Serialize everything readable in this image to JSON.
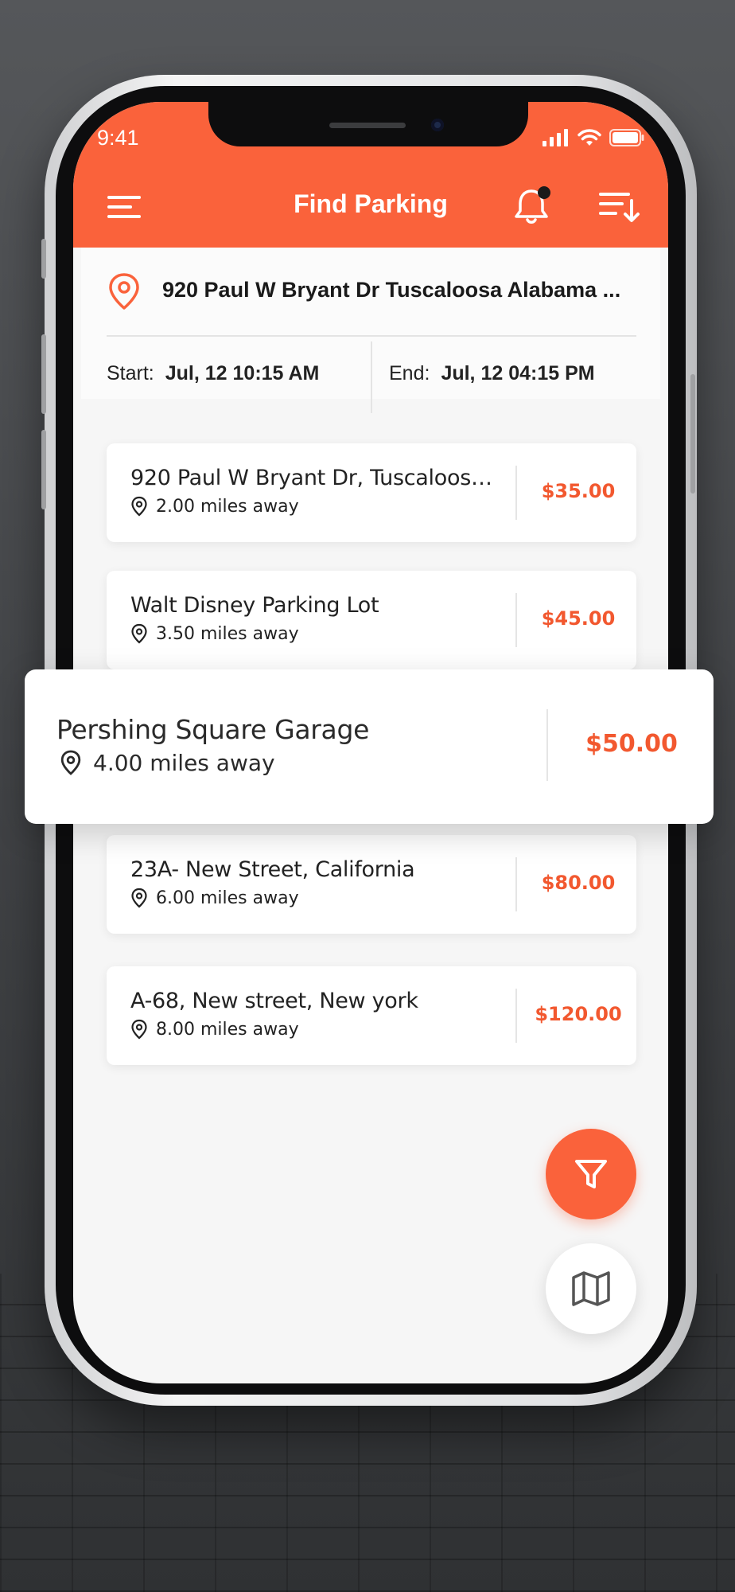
{
  "status_bar": {
    "time": "9:41"
  },
  "header": {
    "title": "Find Parking",
    "menu_icon": "hamburger-icon",
    "notification_icon": "bell-icon",
    "sort_icon": "sort-icon",
    "notification_badge": true
  },
  "search": {
    "address": "920 Paul W Bryant Dr Tuscaloosa Alabama ...",
    "start_label": "Start:",
    "start_value": "Jul, 12 10:15 AM",
    "end_label": "End:",
    "end_value": "Jul, 12 04:15 PM"
  },
  "results": [
    {
      "name": "920 Paul W Bryant Dr, Tuscaloosa, ...",
      "distance": "2.00 miles away",
      "price": "$35.00"
    },
    {
      "name": "Walt Disney Parking Lot",
      "distance": "3.50 miles away",
      "price": "$45.00"
    },
    {
      "name": "23A- New Street, California",
      "distance": "6.00 miles away",
      "price": "$80.00"
    },
    {
      "name": "A-68, New street, New york",
      "distance": "8.00 miles away",
      "price": "$120.00"
    }
  ],
  "highlighted": {
    "name": "Pershing Square Garage",
    "distance": "4.00 miles away",
    "price": "$50.00"
  },
  "fabs": {
    "filter_icon": "filter-icon",
    "map_icon": "map-icon"
  },
  "colors": {
    "accent": "#fa623b",
    "price": "#f2582f",
    "background": "#f6f6f6"
  }
}
